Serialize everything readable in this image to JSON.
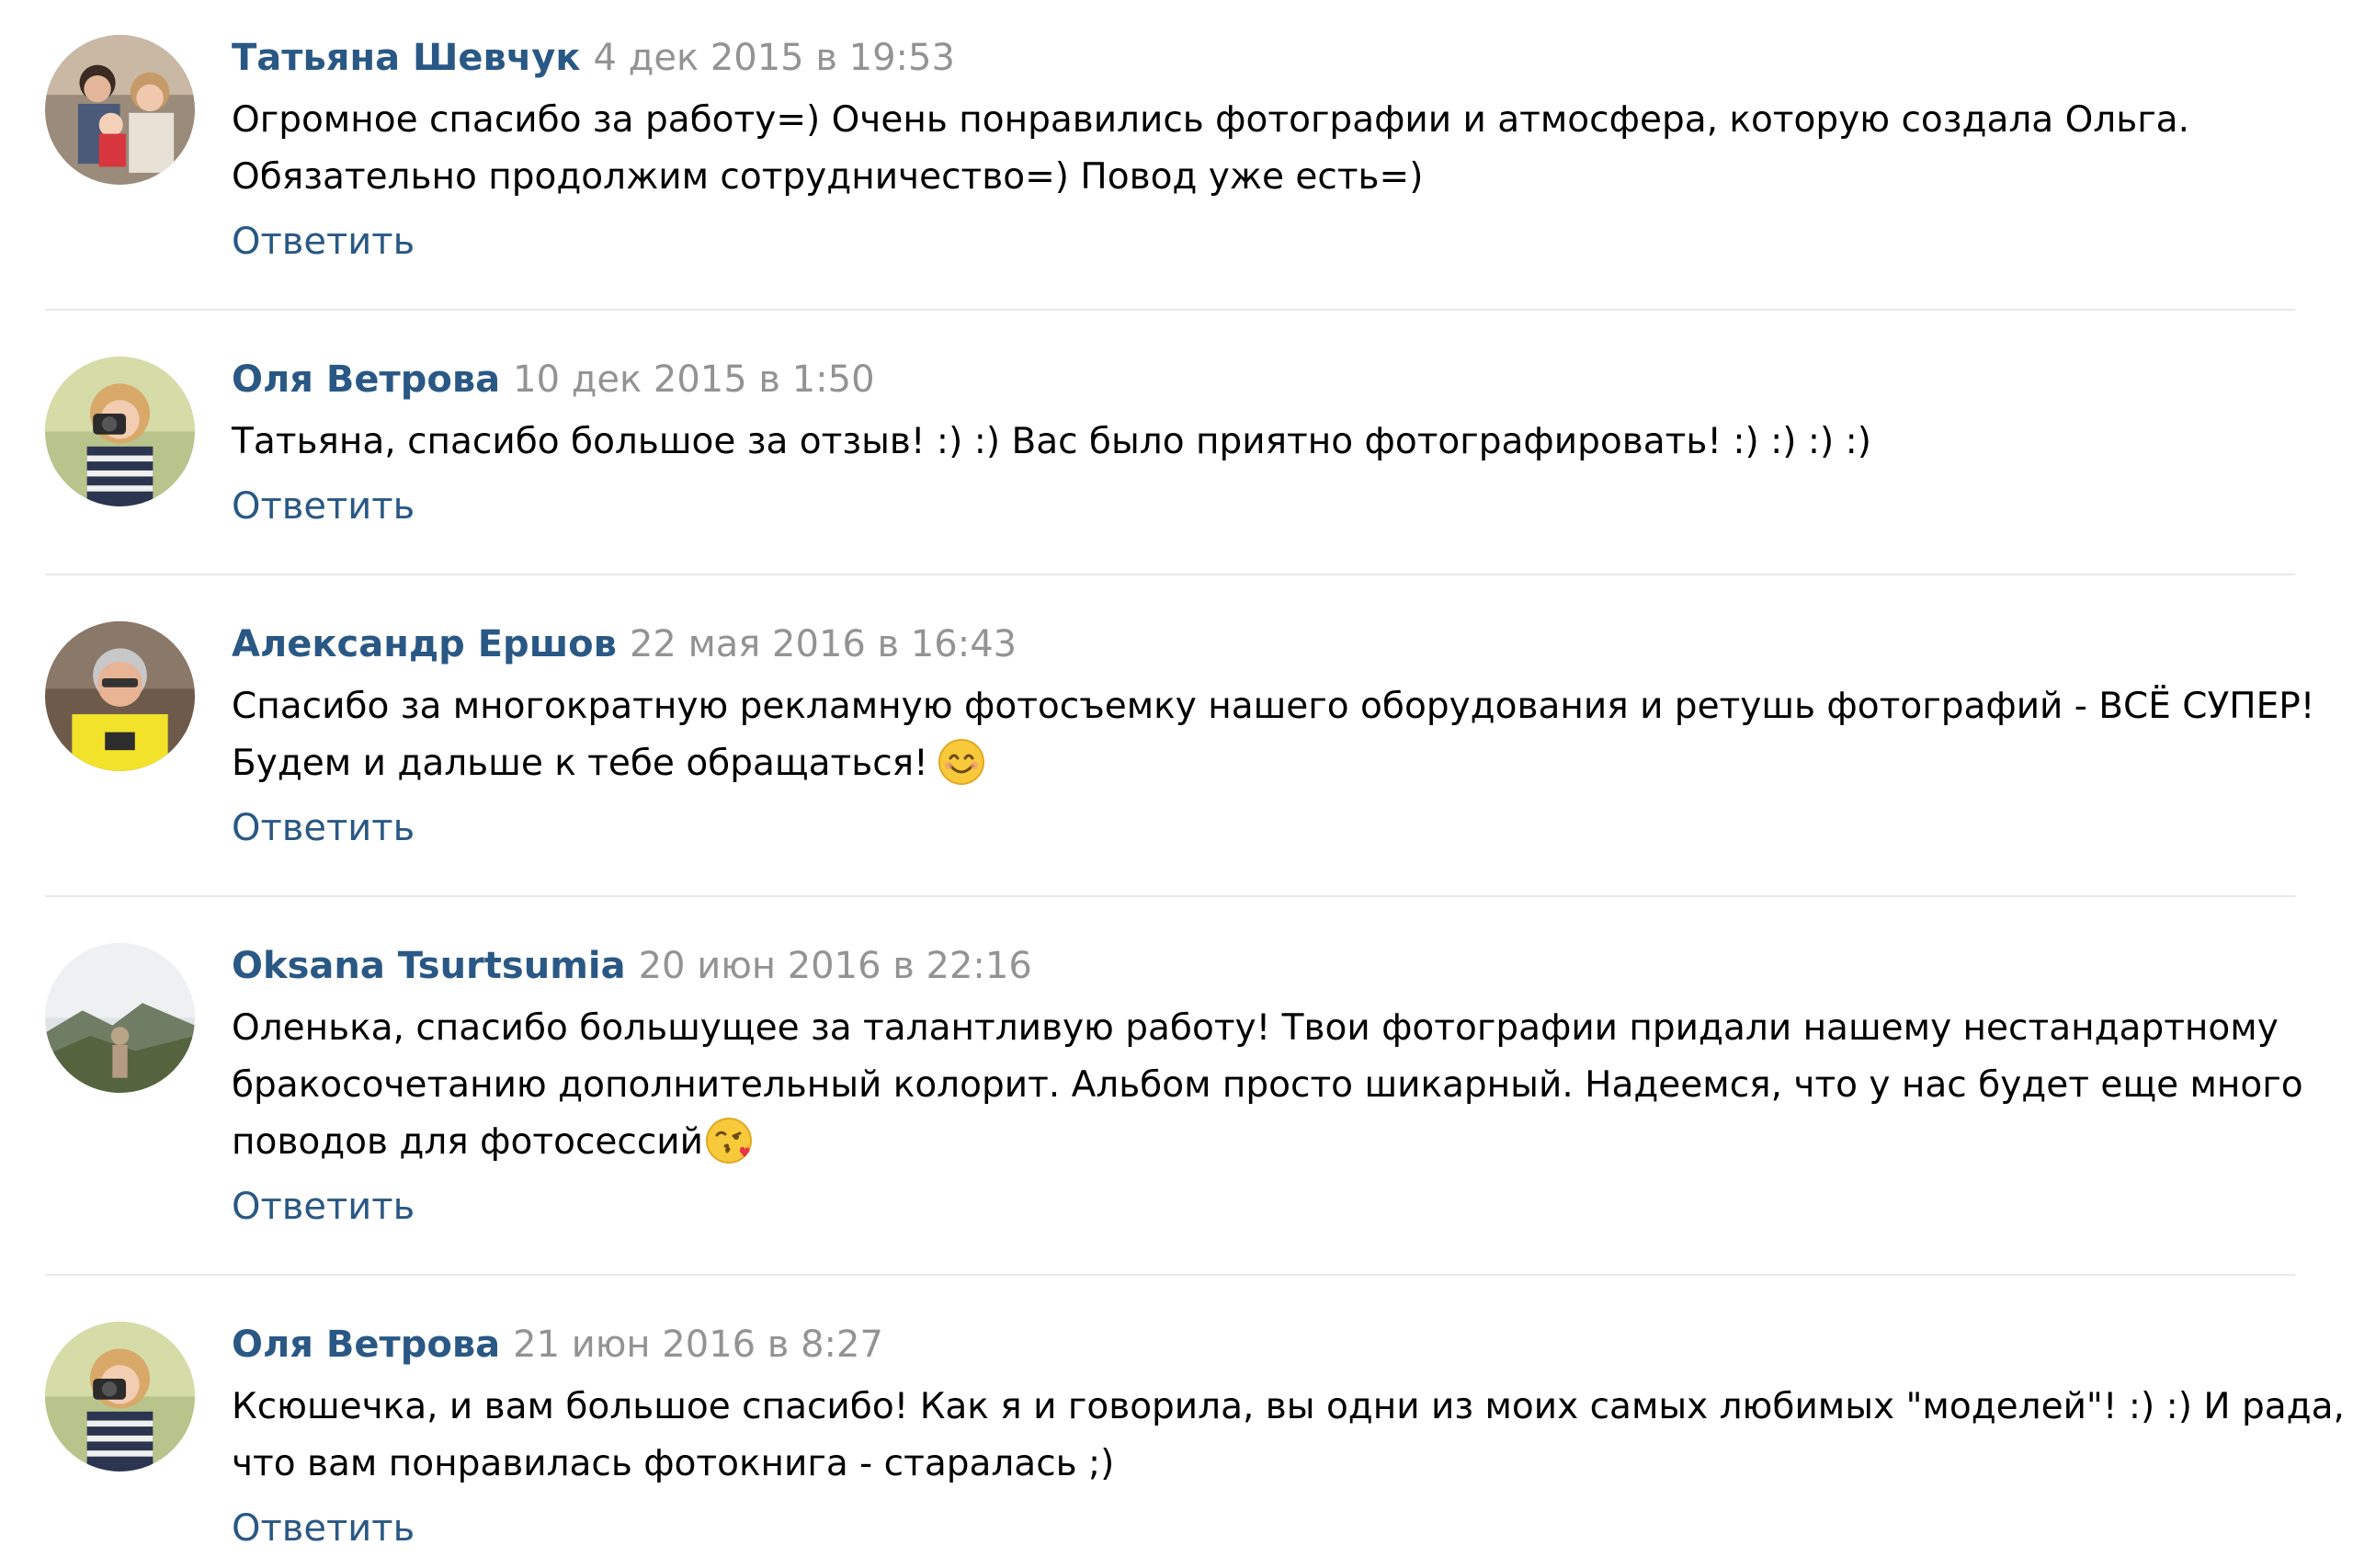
{
  "comments": [
    {
      "author": "Татьяна Шевчук",
      "date": "4 дек 2015 в 19:53",
      "lines": [
        "Огромное спасибо за работу=) Очень понравились фотографии и атмосфера, которую создала Ольга.",
        "Обязательно продолжим сотрудничество=) Повод уже есть=)"
      ],
      "reply_label": "Ответить"
    },
    {
      "author": "Оля Ветрова",
      "date": "10 дек 2015 в 1:50",
      "lines": [
        "Татьяна, спасибо большое за отзыв! :) :) Вас было приятно фотографировать! :) :) :) :)"
      ],
      "reply_label": "Ответить"
    },
    {
      "author": "Александр Ершов",
      "date": "22 мая 2016 в 16:43",
      "lines": [
        "Спасибо за многократную рекламную фотосъемку нашего оборудования и ретушь фотографий - ВСЁ СУПЕР!",
        "Будем и дальше к тебе обращаться!"
      ],
      "reply_label": "Ответить"
    },
    {
      "author": "Oksana Tsurtsumia",
      "date": "20 июн 2016 в 22:16",
      "lines": [
        "Оленька, спасибо большущее за талантливую работу! Твои фотографии придали нашему нестандартному",
        "бракосочетанию дополнительный колорит. Альбом просто шикарный. Надеемся, что у нас будет еще много",
        "поводов для фотосессий"
      ],
      "reply_label": "Ответить"
    },
    {
      "author": "Оля Ветрова",
      "date": "21 июн 2016 в 8:27",
      "lines": [
        "Ксюшечка, и вам большое спасибо! Как я и говорила, вы одни из моих самых любимых \"моделей\"! :) :) И рада,",
        "что вам понравилась фотокнига - старалась ;)"
      ],
      "reply_label": "Ответить"
    }
  ],
  "icons": {
    "smile_emoji": "smiling-face-emoji",
    "kiss_emoji": "face-blowing-kiss-emoji"
  },
  "colors": {
    "author": "#2a5885",
    "date": "#939393",
    "reply": "#2a5885",
    "divider": "#e7e8ec"
  }
}
